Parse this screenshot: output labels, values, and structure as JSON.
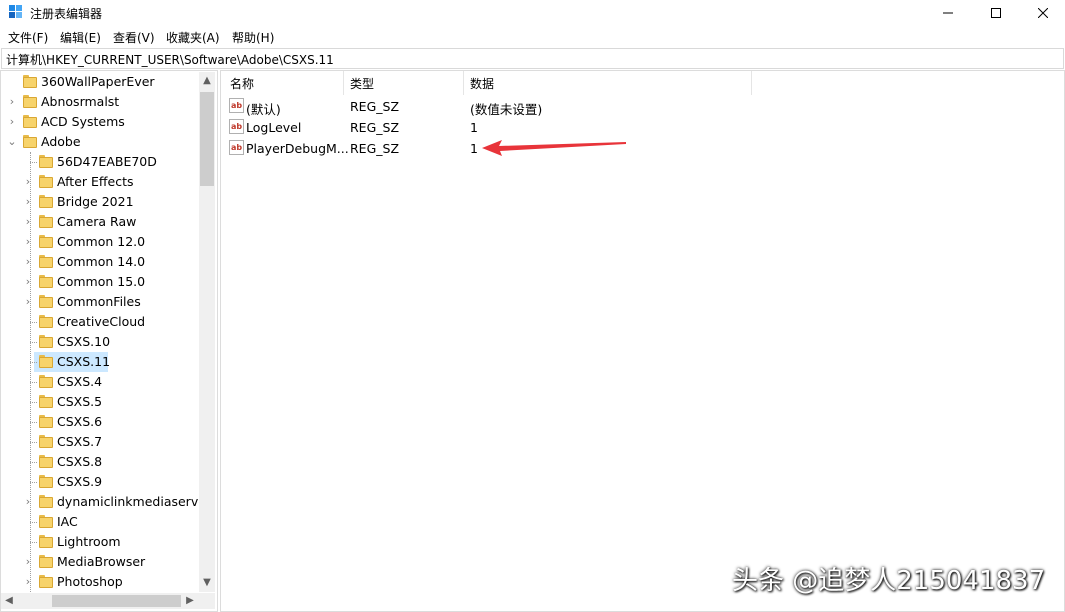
{
  "window": {
    "title": "注册表编辑器",
    "controls": {
      "minimize": "—",
      "maximize": "☐",
      "close": "✕"
    }
  },
  "menu": [
    "文件(F)",
    "编辑(E)",
    "查看(V)",
    "收藏夹(A)",
    "帮助(H)"
  ],
  "address": "计算机\\HKEY_CURRENT_USER\\Software\\Adobe\\CSXS.11",
  "tree": {
    "top_items": [
      {
        "label": "360WallPaperEver",
        "expandable": false
      },
      {
        "label": "Abnosrmalst",
        "expandable": true
      },
      {
        "label": "ACD Systems",
        "expandable": true
      },
      {
        "label": "Adobe",
        "expandable": true,
        "expanded": true
      }
    ],
    "adobe_children": [
      {
        "label": "56D47EABE70D",
        "expandable": false
      },
      {
        "label": "After Effects",
        "expandable": true
      },
      {
        "label": "Bridge 2021",
        "expandable": true
      },
      {
        "label": "Camera Raw",
        "expandable": true
      },
      {
        "label": "Common 12.0",
        "expandable": true
      },
      {
        "label": "Common 14.0",
        "expandable": true
      },
      {
        "label": "Common 15.0",
        "expandable": true
      },
      {
        "label": "CommonFiles",
        "expandable": true
      },
      {
        "label": "CreativeCloud",
        "expandable": false
      },
      {
        "label": "CSXS.10",
        "expandable": false
      },
      {
        "label": "CSXS.11",
        "expandable": false,
        "selected": true
      },
      {
        "label": "CSXS.4",
        "expandable": false
      },
      {
        "label": "CSXS.5",
        "expandable": false
      },
      {
        "label": "CSXS.6",
        "expandable": false
      },
      {
        "label": "CSXS.7",
        "expandable": false
      },
      {
        "label": "CSXS.8",
        "expandable": false
      },
      {
        "label": "CSXS.9",
        "expandable": false
      },
      {
        "label": "dynamiclinkmediaserver",
        "expandable": true
      },
      {
        "label": "IAC",
        "expandable": false
      },
      {
        "label": "Lightroom",
        "expandable": false
      },
      {
        "label": "MediaBrowser",
        "expandable": true
      },
      {
        "label": "Photoshop",
        "expandable": true
      }
    ]
  },
  "values": {
    "columns": {
      "name": "名称",
      "type": "类型",
      "data": "数据"
    },
    "rows": [
      {
        "name": "(默认)",
        "type": "REG_SZ",
        "data": "(数值未设置)"
      },
      {
        "name": "LogLevel",
        "type": "REG_SZ",
        "data": "1"
      },
      {
        "name": "PlayerDebugM...",
        "type": "REG_SZ",
        "data": "1"
      }
    ],
    "icon": "ab-string-icon"
  },
  "annotation": {
    "arrow_color": "#e8343a",
    "points_to_row": 2
  },
  "watermark": "头条 @追梦人215041837"
}
